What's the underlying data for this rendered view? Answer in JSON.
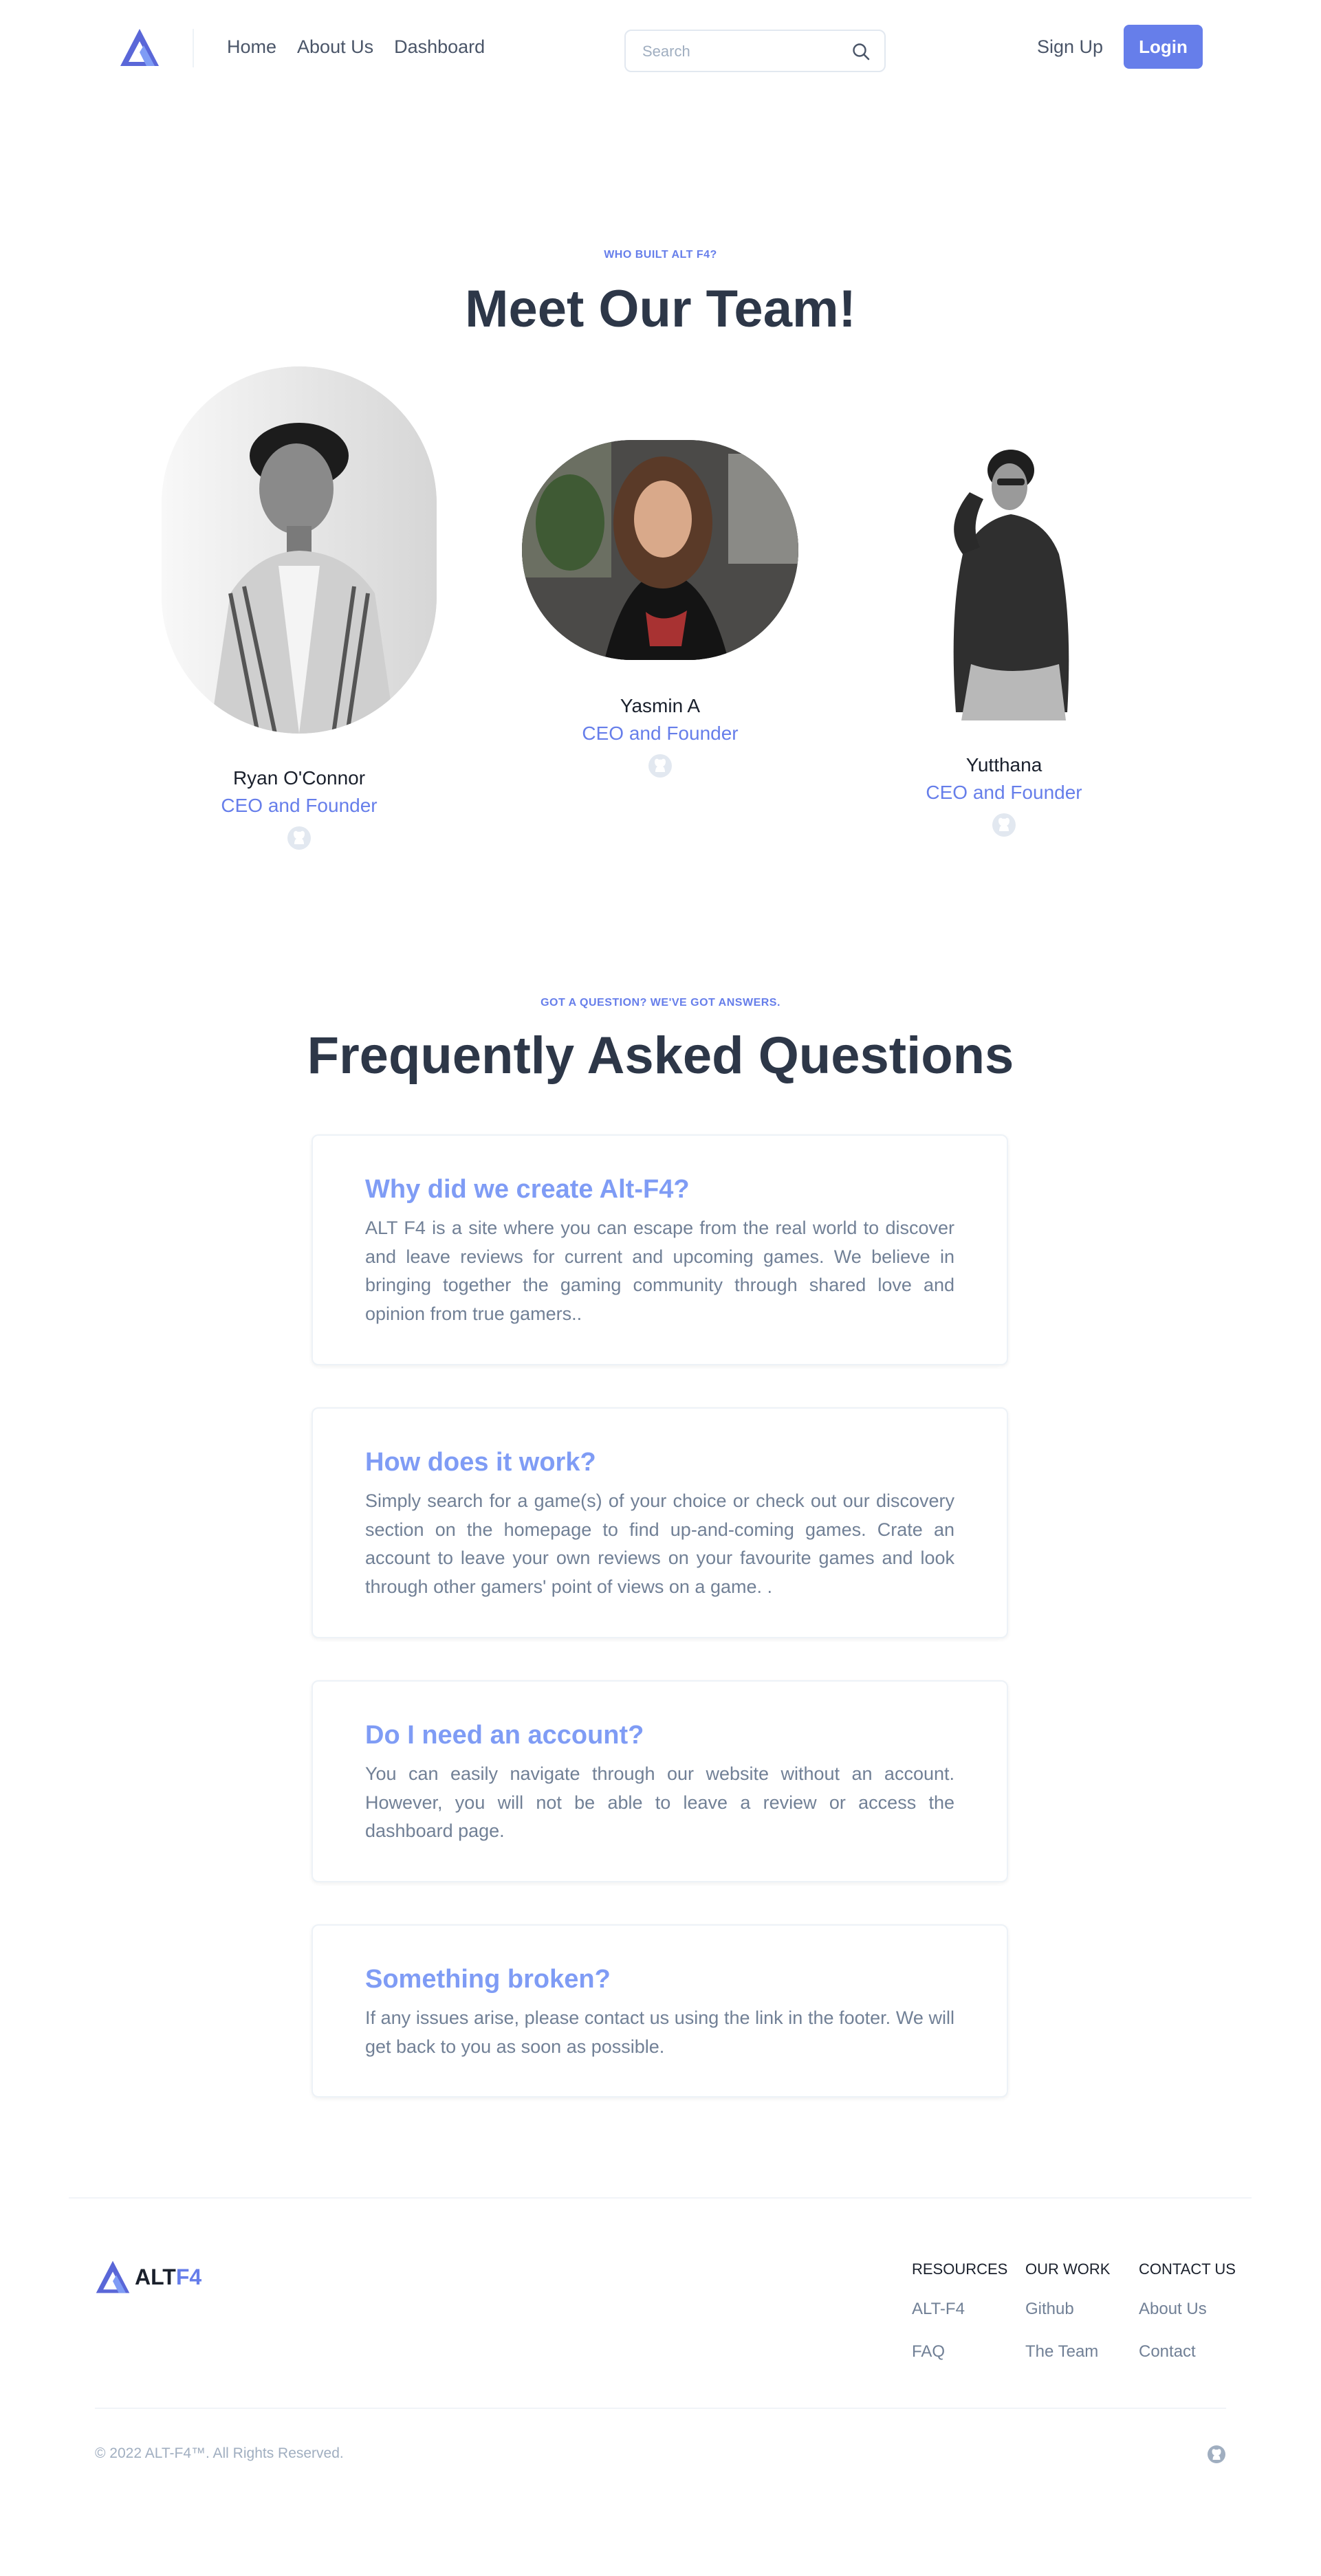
{
  "colors": {
    "accent": "#667eea",
    "accent_light": "#7f9cf5",
    "heading": "#2d3748",
    "muted": "#718096",
    "border": "#edf2f7"
  },
  "nav": {
    "logo_icon": "altf4-triangle-logo",
    "links": [
      "Home",
      "About Us",
      "Dashboard"
    ],
    "search": {
      "placeholder": "Search",
      "icon": "search-icon"
    },
    "signup": "Sign Up",
    "login": "Login"
  },
  "team": {
    "eyebrow": "WHO BUILT ALT F4?",
    "title": "Meet Our Team!",
    "members": [
      {
        "name": "Ryan O'Connor",
        "role": "CEO and Founder",
        "icon": "github-icon"
      },
      {
        "name": "Yasmin A",
        "role": "CEO and Founder",
        "icon": "github-icon"
      },
      {
        "name": "Yutthana",
        "role": "CEO and Founder",
        "icon": "github-icon"
      }
    ]
  },
  "faq": {
    "eyebrow": "GOT A QUESTION? WE'VE GOT ANSWERS.",
    "title": "Frequently Asked Questions",
    "items": [
      {
        "q": "Why did we create Alt-F4?",
        "a": "ALT F4 is a site where you can escape from the real world to discover and leave reviews for current and upcoming games. We believe in bringing together the gaming community through shared love and opinion from true gamers.."
      },
      {
        "q": "How does it work?",
        "a": "Simply search for a game(s) of your choice or check out our discovery section on the homepage to find up-and-coming games. Crate an account to leave your own reviews on your favourite games and look through other gamers' point of views on a game. ."
      },
      {
        "q": "Do I need an account?",
        "a": "You can easily navigate through our website without an account. However, you will not be able to leave a review or access the dashboard page."
      },
      {
        "q": "Something broken?",
        "a": "If any issues arise, please contact us using the link in the footer. We will get back to you as soon as possible."
      }
    ]
  },
  "footer": {
    "brand_a": "ALT",
    "brand_b": "F4",
    "columns": [
      {
        "head": "RESOURCES",
        "links": [
          "ALT-F4",
          "FAQ"
        ]
      },
      {
        "head": "OUR WORK",
        "links": [
          "Github",
          "The Team"
        ]
      },
      {
        "head": "CONTACT US",
        "links": [
          "About Us",
          "Contact"
        ]
      }
    ],
    "copyright": "© 2022 ALT-F4™. All Rights Reserved.",
    "social_icon": "github-icon"
  }
}
